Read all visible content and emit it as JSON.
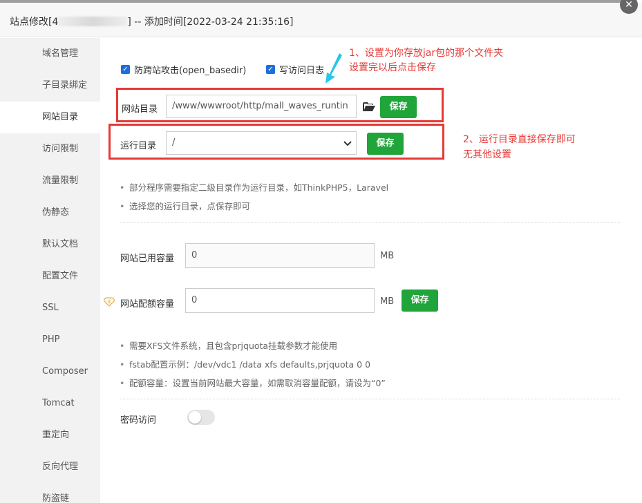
{
  "dialog": {
    "title_prefix": "站点修改[4",
    "title_suffix": "] -- 添加时间[2022-03-24 21:35:16]",
    "close_glyph": "✕"
  },
  "sidebar": {
    "items": [
      {
        "label": "域名管理"
      },
      {
        "label": "子目录绑定"
      },
      {
        "label": "网站目录"
      },
      {
        "label": "访问限制"
      },
      {
        "label": "流量限制"
      },
      {
        "label": "伪静态"
      },
      {
        "label": "默认文档"
      },
      {
        "label": "配置文件"
      },
      {
        "label": "SSL"
      },
      {
        "label": "PHP"
      },
      {
        "label": "Composer"
      },
      {
        "label": "Tomcat"
      },
      {
        "label": "重定向"
      },
      {
        "label": "反向代理"
      },
      {
        "label": "防盗链"
      }
    ],
    "active": "网站目录"
  },
  "options": {
    "open_basedir_label": "防跨站攻击(open_basedir)",
    "access_log_label": "写访问日志"
  },
  "site_dir": {
    "label": "网站目录",
    "value": "/www/wwwroot/http/mall_waves_runtin",
    "save_label": "保存"
  },
  "run_dir": {
    "label": "运行目录",
    "value": "/",
    "save_label": "保存"
  },
  "annotations": {
    "note1_line1": "1、设置为你存放jar包的那个文件夹",
    "note1_line2": "设置完以后点击保存",
    "note2_line1": "2、运行目录直接保存即可",
    "note2_line2": "无其他设置"
  },
  "tips_run": [
    "部分程序需要指定二级目录作为运行目录，如ThinkPHP5，Laravel",
    "选择您的运行目录，点保存即可"
  ],
  "quota": {
    "used_label": "网站已用容量",
    "used_value": "0",
    "used_unit": "MB",
    "limit_label": "网站配额容量",
    "limit_value": "0",
    "limit_unit": "MB",
    "save_label": "保存"
  },
  "tips_quota": [
    "需要XFS文件系统，且包含prjquota挂载参数才能使用",
    "fstab配置示例：/dev/vdc1 /data xfs defaults,prjquota 0 0",
    "配额容量：设置当前网站最大容量，如需取消容量配额，请设为“0”"
  ],
  "password_access": {
    "label": "密码访问",
    "enabled": false
  },
  "colors": {
    "accent_green": "#20a53a",
    "annotation_red": "#e53935",
    "checkbox_blue": "#1e6fd9",
    "arrow_cyan": "#29c6e8"
  }
}
